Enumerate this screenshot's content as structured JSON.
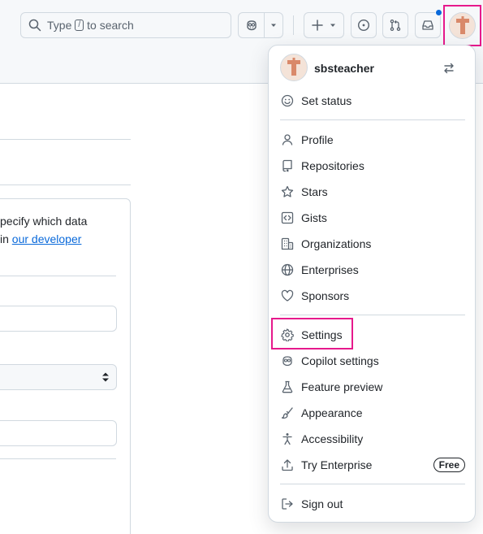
{
  "header": {
    "search": {
      "prefix": "Type",
      "key": "/",
      "suffix": "to search"
    },
    "notification_dot_color": "#0969da",
    "highlight_color": "#e6198c"
  },
  "background": {
    "intro_line_1": "pecify which data",
    "intro_line_2_prefix": "in ",
    "intro_link": "our developer"
  },
  "menu": {
    "username": "sbsteacher",
    "set_status": "Set status",
    "items_group1": [
      {
        "label": "Profile",
        "icon": "person-icon"
      },
      {
        "label": "Repositories",
        "icon": "repo-icon"
      },
      {
        "label": "Stars",
        "icon": "star-icon"
      },
      {
        "label": "Gists",
        "icon": "code-square-icon"
      },
      {
        "label": "Organizations",
        "icon": "organization-icon"
      },
      {
        "label": "Enterprises",
        "icon": "globe-icon"
      },
      {
        "label": "Sponsors",
        "icon": "heart-icon"
      }
    ],
    "items_group2": [
      {
        "label": "Settings",
        "icon": "gear-icon"
      },
      {
        "label": "Copilot settings",
        "icon": "copilot-icon"
      },
      {
        "label": "Feature preview",
        "icon": "beaker-icon"
      },
      {
        "label": "Appearance",
        "icon": "paintbrush-icon"
      },
      {
        "label": "Accessibility",
        "icon": "accessibility-icon"
      },
      {
        "label": "Try Enterprise",
        "icon": "upload-icon",
        "badge": "Free"
      }
    ],
    "sign_out": "Sign out"
  }
}
